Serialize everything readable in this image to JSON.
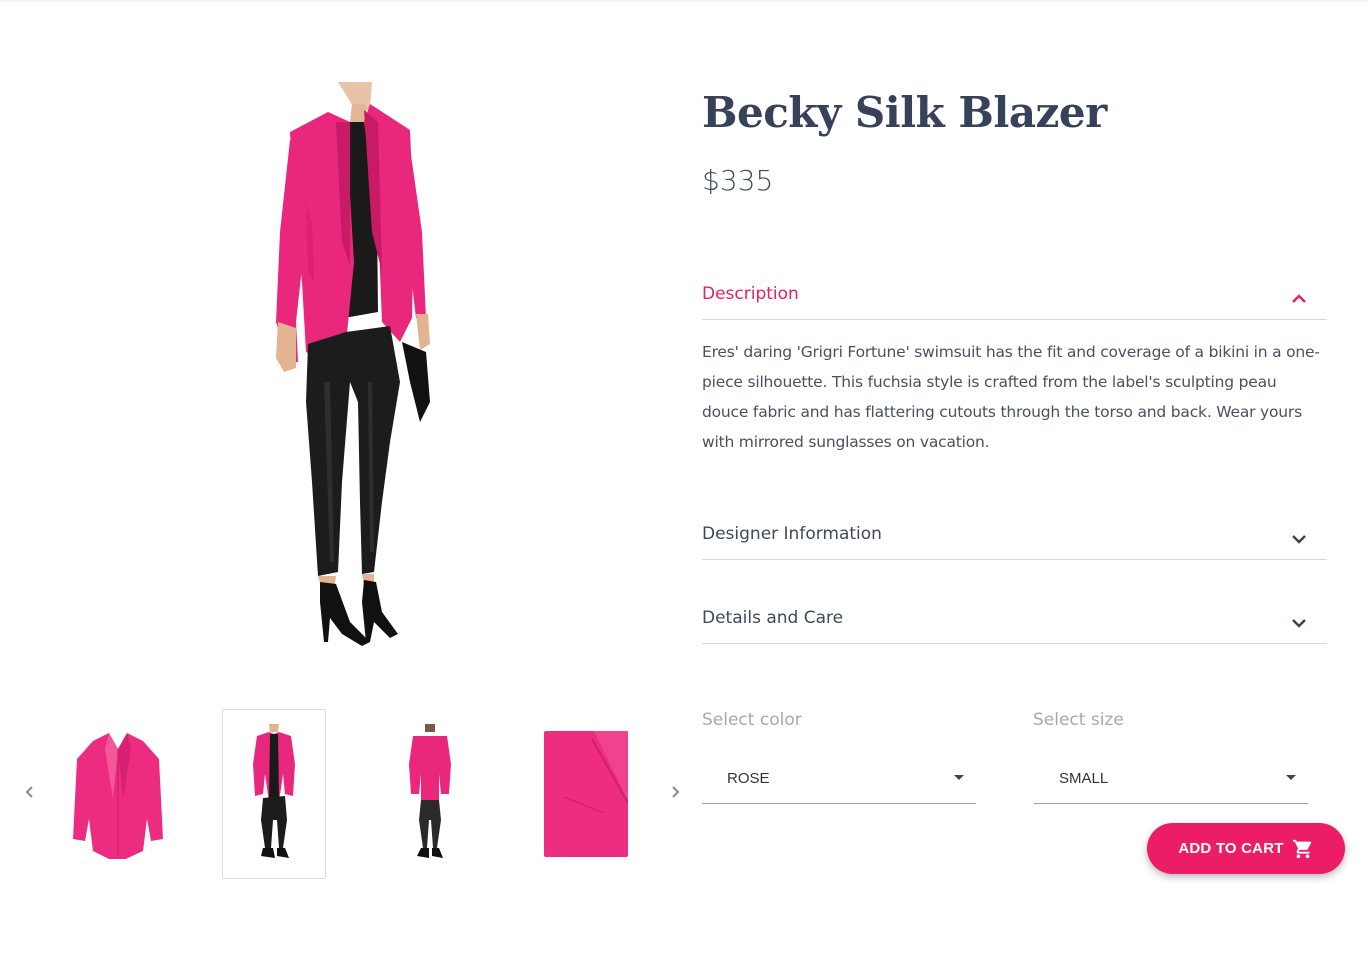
{
  "product": {
    "title": "Becky Silk Blazer",
    "price": "$335",
    "images": {
      "main": "model-wearing-pink-blazer",
      "thumbnails": [
        {
          "name": "blazer-flat"
        },
        {
          "name": "model-front",
          "active": true
        },
        {
          "name": "model-back"
        },
        {
          "name": "fabric-closeup"
        }
      ]
    }
  },
  "accordion": {
    "description": {
      "label": "Description",
      "expanded": true,
      "icon": "chevron-up-icon",
      "text": "Eres' daring 'Grigri Fortune' swimsuit has the fit and coverage of a bikini in a one-piece silhouette. This fuchsia style is crafted from the label's sculpting peau douce fabric and has flattering cutouts through the torso and back. Wear yours with mirrored sunglasses on vacation."
    },
    "designer": {
      "label": "Designer Information",
      "expanded": false,
      "icon": "chevron-down-icon"
    },
    "details": {
      "label": "Details and Care",
      "expanded": false,
      "icon": "chevron-down-icon"
    }
  },
  "options": {
    "color": {
      "label": "Select color",
      "value": "ROSE"
    },
    "size": {
      "label": "Select size",
      "value": "SMALL"
    }
  },
  "cart": {
    "label": "ADD TO CART",
    "icon": "cart-icon"
  },
  "colors": {
    "accent": "#ec1c66",
    "title": "#37425a",
    "text": "#4a5060",
    "blazer": "#e9277d"
  }
}
